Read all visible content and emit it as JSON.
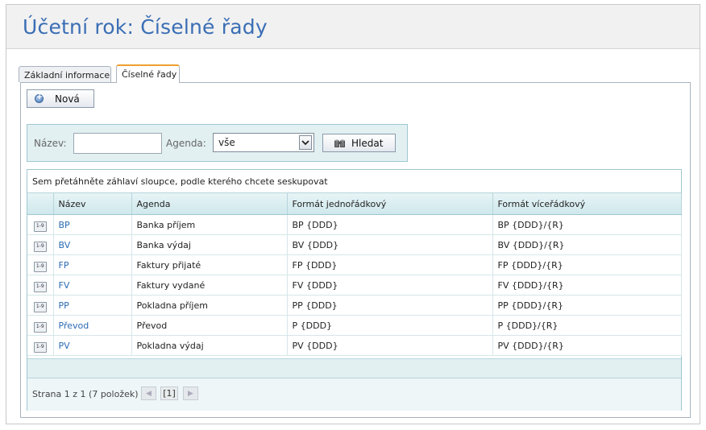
{
  "page": {
    "title": "Účetní rok: Číselné řady"
  },
  "tabs": [
    {
      "label": "Základní informace",
      "active": false
    },
    {
      "label": "Číselné řady",
      "active": true
    }
  ],
  "toolbar": {
    "new_label": "Nová"
  },
  "filter": {
    "name_label": "Název:",
    "name_value": "",
    "agenda_label": "Agenda:",
    "agenda_selected": "vše",
    "search_label": "Hledat"
  },
  "grid": {
    "group_hint": "Sem přetáhněte záhlaví sloupce, podle kterého chcete seskupovat",
    "columns": [
      "Název",
      "Agenda",
      "Formát jednořádkový",
      "Formát víceřádkový"
    ],
    "rows": [
      {
        "name": "BP",
        "agenda": "Banka příjem",
        "single": "BP {DDD}",
        "multi": "BP {DDD}/{R}"
      },
      {
        "name": "BV",
        "agenda": "Banka výdaj",
        "single": "BV {DDD}",
        "multi": "BV {DDD}/{R}"
      },
      {
        "name": "FP",
        "agenda": "Faktury přijaté",
        "single": "FP {DDD}",
        "multi": "FP {DDD}/{R}"
      },
      {
        "name": "FV",
        "agenda": "Faktury vydané",
        "single": "FV {DDD}",
        "multi": "FV {DDD}/{R}"
      },
      {
        "name": "PP",
        "agenda": "Pokladna příjem",
        "single": "PP {DDD}",
        "multi": "PP {DDD}/{R}"
      },
      {
        "name": "Převod",
        "agenda": "Převod",
        "single": "P {DDD}",
        "multi": "P {DDD}/{R}"
      },
      {
        "name": "PV",
        "agenda": "Pokladna výdaj",
        "single": "PV {DDD}",
        "multi": "PV {DDD}/{R}"
      }
    ],
    "row_icon": "number-sequence-icon",
    "row_icon_text": "1-9"
  },
  "pager": {
    "info": "Strana 1 z 1 (7 položek)",
    "current": "[1]"
  },
  "colors": {
    "title": "#3a6eb5",
    "link": "#2a6ab3",
    "filter_bg": "#e2f0f2",
    "grid_header": "#cfe8ec",
    "active_tab_accent": "#f0a030"
  }
}
